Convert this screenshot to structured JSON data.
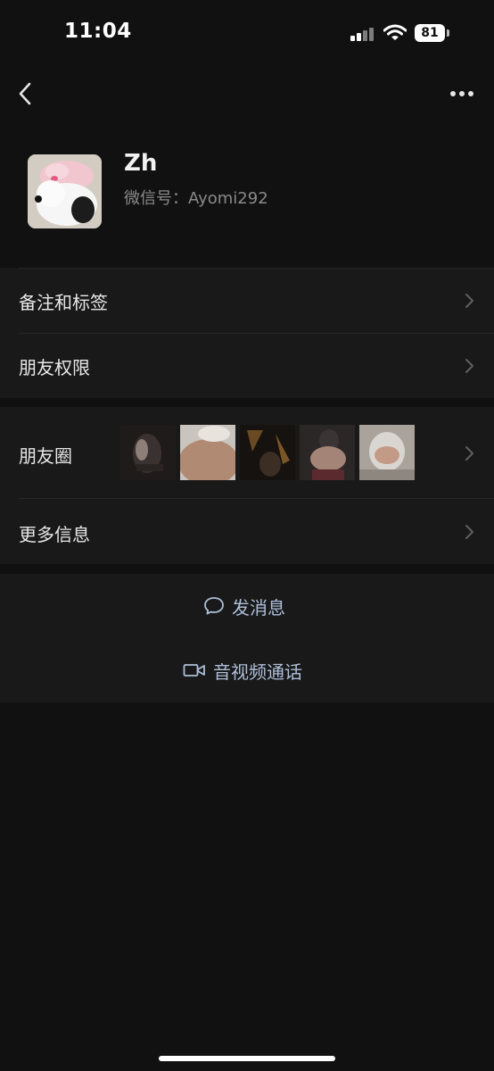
{
  "status_bar": {
    "time": "11:04",
    "battery": "81"
  },
  "nav": {
    "back_icon": "chevron-left-icon",
    "more_icon": "ellipsis-icon"
  },
  "profile": {
    "name": "Zh",
    "wechat_id": "微信号：Ayomi292"
  },
  "menu": {
    "remarks_tags": "备注和标签",
    "friend_permissions": "朋友权限",
    "moments": "朋友圈",
    "more_info": "更多信息"
  },
  "actions": {
    "send_message": "发消息",
    "av_call": "音视频通话"
  },
  "colors": {
    "background": "#111111",
    "row": "#191919",
    "action_text": "#aebfd9"
  }
}
